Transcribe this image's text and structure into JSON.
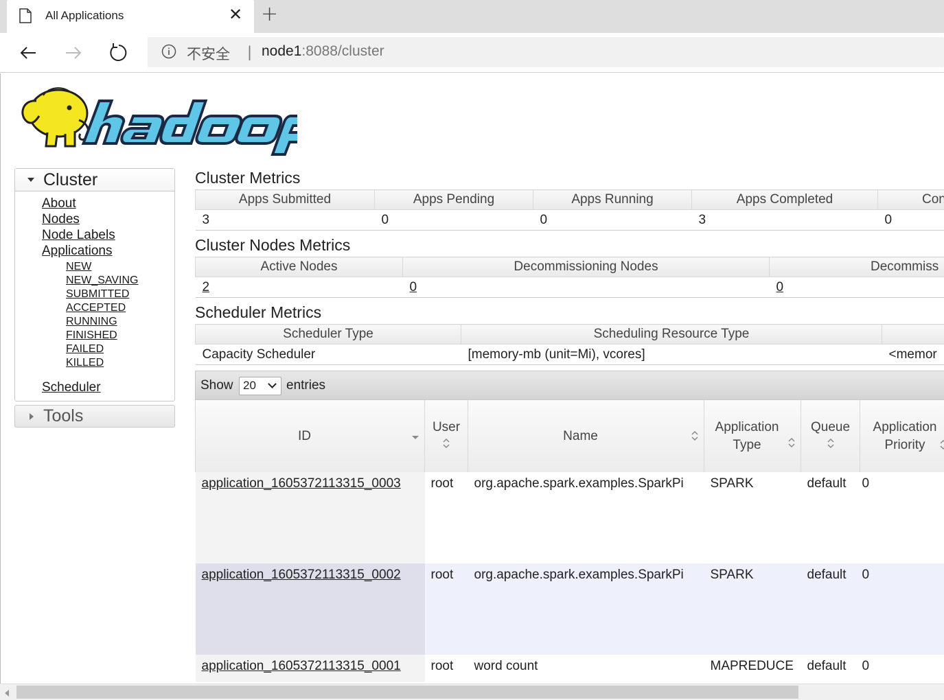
{
  "browser": {
    "tab_title": "All Applications",
    "address_insecure": "不安全",
    "address_host": "node1",
    "address_path": ":8088/cluster"
  },
  "sidebar": {
    "cluster_label": "Cluster",
    "links": [
      "About",
      "Nodes",
      "Node Labels",
      "Applications"
    ],
    "app_states": [
      "NEW",
      "NEW_SAVING",
      "SUBMITTED",
      "ACCEPTED",
      "RUNNING",
      "FINISHED",
      "FAILED",
      "KILLED"
    ],
    "scheduler_label": "Scheduler",
    "tools_label": "Tools"
  },
  "cluster_metrics": {
    "title": "Cluster Metrics",
    "headers": [
      "Apps Submitted",
      "Apps Pending",
      "Apps Running",
      "Apps Completed",
      "Con"
    ],
    "values": [
      "3",
      "0",
      "0",
      "3",
      "0"
    ]
  },
  "nodes_metrics": {
    "title": "Cluster Nodes Metrics",
    "headers": [
      "Active Nodes",
      "Decommissioning Nodes",
      "Decommiss"
    ],
    "values": [
      "2",
      "0",
      "0"
    ]
  },
  "scheduler_metrics": {
    "title": "Scheduler Metrics",
    "headers": [
      "Scheduler Type",
      "Scheduling Resource Type",
      ""
    ],
    "values": [
      "Capacity Scheduler",
      "[memory-mb (unit=Mi), vcores]",
      "<memor"
    ]
  },
  "apps_table": {
    "show_label": "Show",
    "page_size": "20",
    "entries_label": "entries",
    "headers": {
      "id": "ID",
      "user": "User",
      "name": "Name",
      "type": "Application Type",
      "queue": "Queue",
      "priority": "Application Priority"
    },
    "rows": [
      {
        "id": "application_1605372113315_0003",
        "user": "root",
        "name": "org.apache.spark.examples.SparkPi",
        "type": "SPARK",
        "queue": "default",
        "priority": "0"
      },
      {
        "id": "application_1605372113315_0002",
        "user": "root",
        "name": "org.apache.spark.examples.SparkPi",
        "type": "SPARK",
        "queue": "default",
        "priority": "0"
      },
      {
        "id": "application_1605372113315_0001",
        "user": "root",
        "name": "word count",
        "type": "MAPREDUCE",
        "queue": "default",
        "priority": "0"
      }
    ]
  },
  "colors": {
    "logo_yellow": "#f5e622",
    "logo_blue": "#5fc6e8",
    "row_even": "#eef0fb"
  }
}
